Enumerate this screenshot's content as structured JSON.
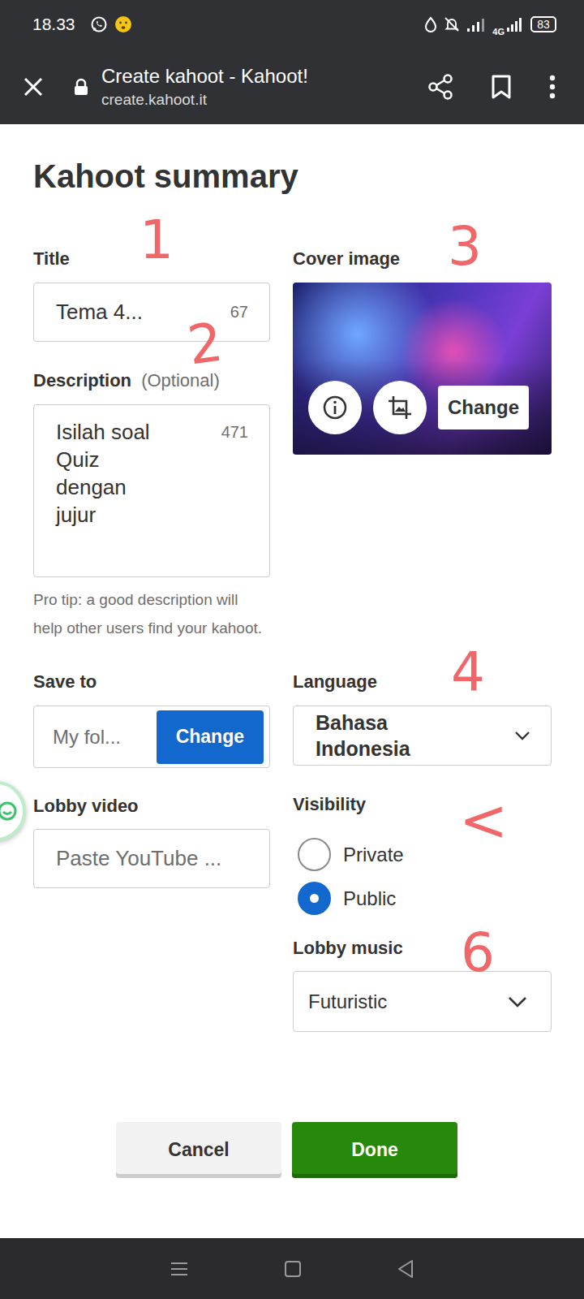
{
  "status_bar": {
    "time": "18.33",
    "network": "4G",
    "battery": "83"
  },
  "browser": {
    "title": "Create kahoot - Kahoot!",
    "url": "create.kahoot.it"
  },
  "heading": "Kahoot summary",
  "title_field": {
    "label": "Title",
    "value": "Tema 4...",
    "count": "67"
  },
  "description_field": {
    "label": "Description",
    "hint": "(Optional)",
    "value": "Isilah soal Quiz dengan jujur",
    "count": "471"
  },
  "tip": "Pro tip: a good description will help other users find your kahoot.",
  "cover_image": {
    "label": "Cover image",
    "button": "Change"
  },
  "save_to": {
    "label": "Save to",
    "value": "My fol...",
    "button": "Change"
  },
  "lobby_video": {
    "label": "Lobby video",
    "placeholder": "Paste YouTube ..."
  },
  "language": {
    "label": "Language",
    "value": "Bahasa Indonesia"
  },
  "visibility": {
    "label": "Visibility",
    "options": [
      {
        "label": "Private",
        "selected": false
      },
      {
        "label": "Public",
        "selected": true
      }
    ]
  },
  "lobby_music": {
    "label": "Lobby music",
    "value": "Futuristic"
  },
  "buttons": [
    {
      "label": "Cancel",
      "kind": "secondary"
    },
    {
      "label": "Done",
      "kind": "primary"
    }
  ],
  "annotations": [
    {
      "label": "1"
    },
    {
      "label": "2"
    },
    {
      "label": "3"
    },
    {
      "label": "4"
    },
    {
      "label": "<"
    },
    {
      "label": "6"
    }
  ]
}
